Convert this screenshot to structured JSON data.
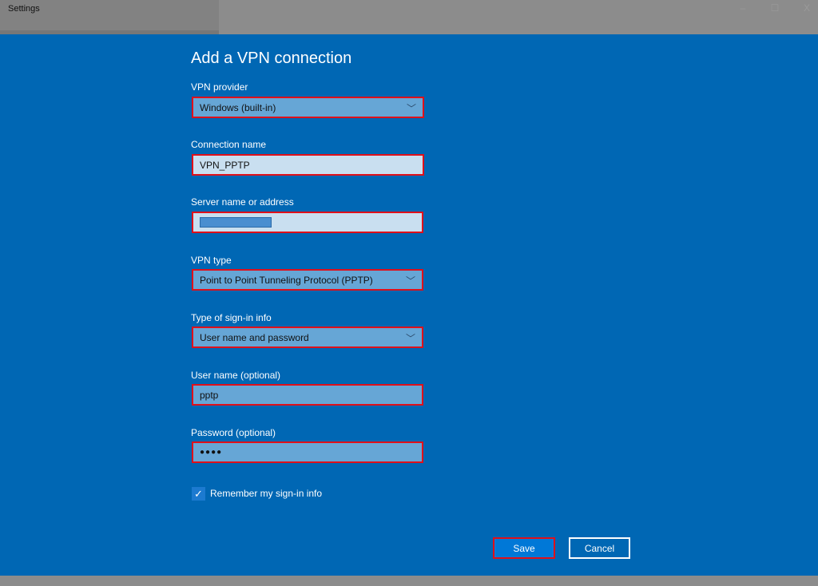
{
  "window": {
    "title": "Settings",
    "minimize": "–",
    "maximize": "☐",
    "close": "X"
  },
  "form": {
    "heading": "Add a VPN connection",
    "provider": {
      "label": "VPN provider",
      "value": "Windows (built-in)"
    },
    "connection_name": {
      "label": "Connection name",
      "value": "VPN_PPTP"
    },
    "server": {
      "label": "Server name or address",
      "value": ""
    },
    "vpn_type": {
      "label": "VPN type",
      "value": "Point to Point Tunneling Protocol (PPTP)"
    },
    "signin_type": {
      "label": "Type of sign-in info",
      "value": "User name and password"
    },
    "username": {
      "label": "User name (optional)",
      "value": "pptp"
    },
    "password": {
      "label": "Password (optional)",
      "value": "●●●●"
    },
    "remember": {
      "label": "Remember my sign-in info",
      "checked": true
    }
  },
  "buttons": {
    "save": "Save",
    "cancel": "Cancel"
  },
  "colors": {
    "panel": "#0067b4",
    "highlight_border": "#e0101a",
    "save_button": "#0078d7"
  }
}
